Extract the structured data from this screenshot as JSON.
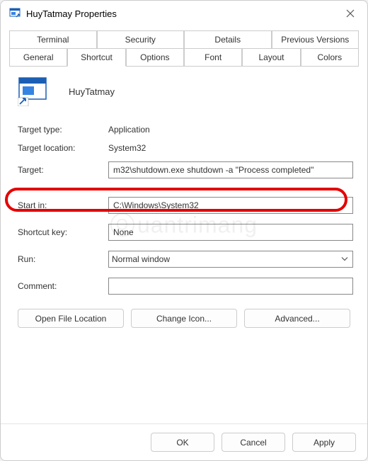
{
  "window": {
    "title": "HuyTatmay Properties"
  },
  "tabs": {
    "row1": [
      "Terminal",
      "Security",
      "Details",
      "Previous Versions"
    ],
    "row2": [
      "General",
      "Shortcut",
      "Options",
      "Font",
      "Layout",
      "Colors"
    ],
    "active": "Shortcut"
  },
  "shortcut": {
    "name": "HuyTatmay",
    "target_type_label": "Target type:",
    "target_type": "Application",
    "target_location_label": "Target location:",
    "target_location": "System32",
    "target_label": "Target:",
    "target": "m32\\shutdown.exe shutdown -a \"Process completed\"",
    "start_in_label": "Start in:",
    "start_in": "C:\\Windows\\System32",
    "shortcut_key_label": "Shortcut key:",
    "shortcut_key": "None",
    "run_label": "Run:",
    "run": "Normal window",
    "comment_label": "Comment:",
    "comment": ""
  },
  "buttons": {
    "open_location": "Open File Location",
    "change_icon": "Change Icon...",
    "advanced": "Advanced..."
  },
  "footer": {
    "ok": "OK",
    "cancel": "Cancel",
    "apply": "Apply"
  },
  "watermark": "uantrimang"
}
